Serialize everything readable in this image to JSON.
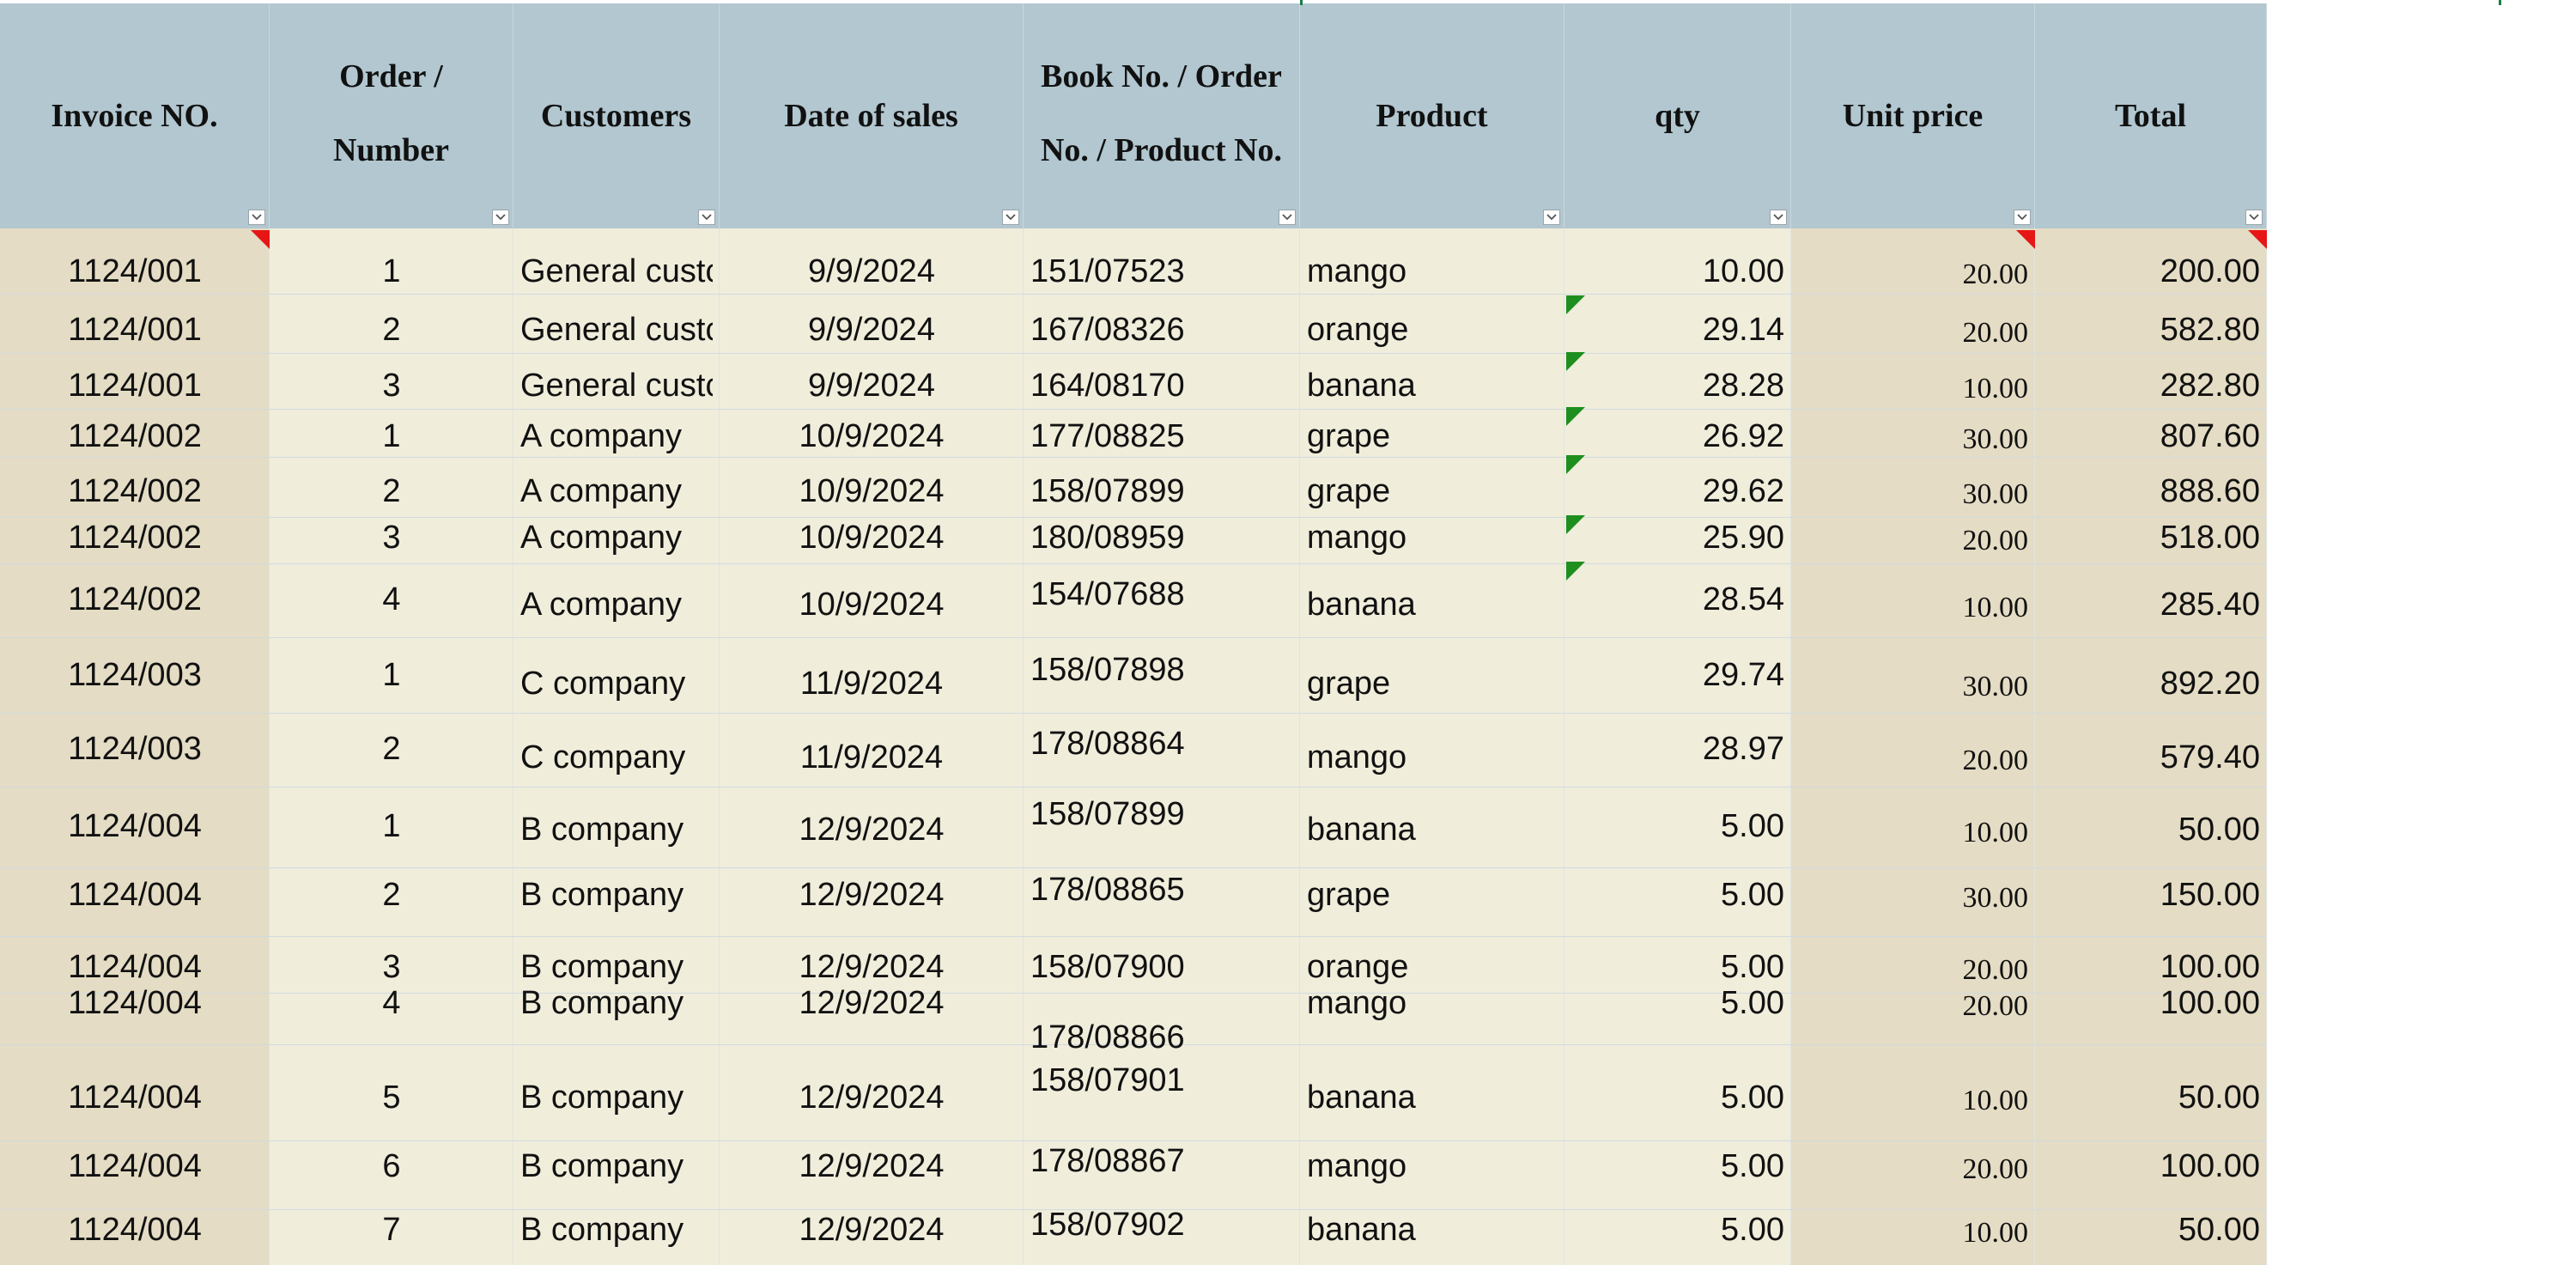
{
  "colors": {
    "header_bg": "#b2c7d0",
    "body_bg_light": "#f0eddb",
    "body_bg_dark": "#e4dcc4",
    "comment_red": "#e61616",
    "error_green": "#1e8f1e"
  },
  "headers": [
    {
      "key": "invoice",
      "label": [
        "Invoice NO."
      ]
    },
    {
      "key": "order",
      "label": [
        "Order /",
        "Number"
      ]
    },
    {
      "key": "customer",
      "label": [
        "Customers"
      ]
    },
    {
      "key": "date",
      "label": [
        "Date of sales"
      ]
    },
    {
      "key": "book",
      "label": [
        "Book No. / Order",
        "No. / Product No."
      ]
    },
    {
      "key": "product",
      "label": [
        "Product"
      ]
    },
    {
      "key": "qty",
      "label": [
        "qty"
      ]
    },
    {
      "key": "unit",
      "label": [
        "Unit price"
      ]
    },
    {
      "key": "total",
      "label": [
        "Total"
      ]
    }
  ],
  "rows": [
    {
      "invoice": "1124/001",
      "order": "1",
      "customer": "General custc",
      "date": "9/9/2024",
      "book": "151/07523",
      "product": "mango",
      "qty": "10.00",
      "unit": "20.00",
      "total": "200.00"
    },
    {
      "invoice": "1124/001",
      "order": "2",
      "customer": "General custc",
      "date": "9/9/2024",
      "book": "167/08326",
      "product": "orange",
      "qty": "29.14",
      "unit": "20.00",
      "total": "582.80"
    },
    {
      "invoice": "1124/001",
      "order": "3",
      "customer": "General custc",
      "date": "9/9/2024",
      "book": "164/08170",
      "product": "banana",
      "qty": "28.28",
      "unit": "10.00",
      "total": "282.80"
    },
    {
      "invoice": "1124/002",
      "order": "1",
      "customer": "A company",
      "date": "10/9/2024",
      "book": "177/08825",
      "product": "grape",
      "qty": "26.92",
      "unit": "30.00",
      "total": "807.60"
    },
    {
      "invoice": "1124/002",
      "order": "2",
      "customer": "A company",
      "date": "10/9/2024",
      "book": "158/07899",
      "product": "grape",
      "qty": "29.62",
      "unit": "30.00",
      "total": "888.60"
    },
    {
      "invoice": "1124/002",
      "order": "3",
      "customer": "A company",
      "date": "10/9/2024",
      "book": "180/08959",
      "product": "mango",
      "qty": "25.90",
      "unit": "20.00",
      "total": "518.00"
    },
    {
      "invoice": "1124/002",
      "order": "4",
      "customer": "A company",
      "date": "10/9/2024",
      "book": "154/07688",
      "product": "banana",
      "qty": "28.54",
      "unit": "10.00",
      "total": "285.40"
    },
    {
      "invoice": "1124/003",
      "order": "1",
      "customer": "C company",
      "date": "11/9/2024",
      "book": "158/07898",
      "product": "grape",
      "qty": "29.74",
      "unit": "30.00",
      "total": "892.20"
    },
    {
      "invoice": "1124/003",
      "order": "2",
      "customer": "C company",
      "date": "11/9/2024",
      "book": "178/08864",
      "product": "mango",
      "qty": "28.97",
      "unit": "20.00",
      "total": "579.40"
    },
    {
      "invoice": "1124/004",
      "order": "1",
      "customer": "B company",
      "date": "12/9/2024",
      "book": "158/07899",
      "product": "banana",
      "qty": "5.00",
      "unit": "10.00",
      "total": "50.00"
    },
    {
      "invoice": "1124/004",
      "order": "2",
      "customer": "B company",
      "date": "12/9/2024",
      "book": "178/08865",
      "product": "grape",
      "qty": "5.00",
      "unit": "30.00",
      "total": "150.00"
    },
    {
      "invoice": "1124/004",
      "order": "3",
      "customer": "B company",
      "date": "12/9/2024",
      "book": "158/07900",
      "product": "orange",
      "qty": "5.00",
      "unit": "20.00",
      "total": "100.00"
    },
    {
      "invoice": "1124/004",
      "order": "4",
      "customer": "B company",
      "date": "12/9/2024",
      "book": "178/08866",
      "product": "mango",
      "qty": "5.00",
      "unit": "20.00",
      "total": "100.00"
    },
    {
      "invoice": "1124/004",
      "order": "5",
      "customer": "B company",
      "date": "12/9/2024",
      "book": "158/07901",
      "product": "banana",
      "qty": "5.00",
      "unit": "10.00",
      "total": "50.00"
    },
    {
      "invoice": "1124/004",
      "order": "6",
      "customer": "B company",
      "date": "12/9/2024",
      "book": "178/08867",
      "product": "mango",
      "qty": "5.00",
      "unit": "20.00",
      "total": "100.00"
    },
    {
      "invoice": "1124/004",
      "order": "7",
      "customer": "B company",
      "date": "12/9/2024",
      "book": "158/07902",
      "product": "banana",
      "qty": "5.00",
      "unit": "10.00",
      "total": "50.00"
    }
  ]
}
